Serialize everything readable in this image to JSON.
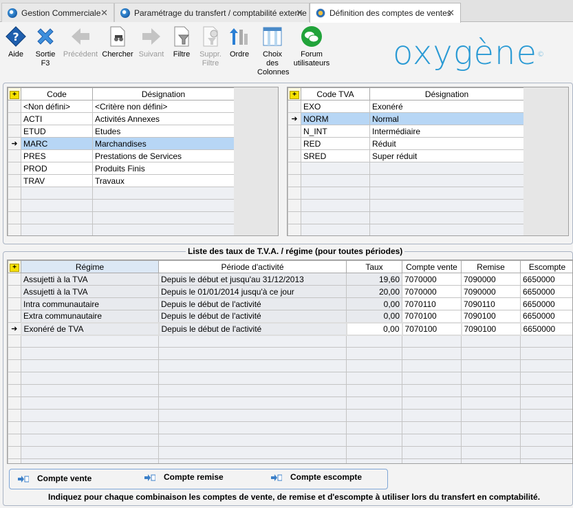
{
  "tabs": [
    {
      "label": "Gestion Commerciale",
      "icon": "app-icon"
    },
    {
      "label": "Paramétrage du transfert / comptabilité externe",
      "icon": "app-icon"
    },
    {
      "label": "Définition des comptes de ventes",
      "icon": "settings-icon"
    }
  ],
  "toolbar": {
    "aide": "Aide",
    "sortie": "Sortie F3",
    "precedent": "Précédent",
    "chercher": "Chercher",
    "suivant": "Suivant",
    "filtre": "Filtre",
    "suppr_filtre": "Suppr. Filtre",
    "ordre": "Ordre",
    "choix_colonnes": "Choix des Colonnes",
    "forum": "Forum utilisateurs"
  },
  "logo": {
    "text": "oxygène",
    "tm": "©"
  },
  "left_grid": {
    "headers": {
      "code": "Code",
      "designation": "Désignation"
    },
    "rows": [
      {
        "code": "<Non défini>",
        "designation": "<Critère non défini>"
      },
      {
        "code": "ACTI",
        "designation": "Activités Annexes"
      },
      {
        "code": "ETUD",
        "designation": "Etudes"
      },
      {
        "code": "MARC",
        "designation": "Marchandises"
      },
      {
        "code": "PRES",
        "designation": "Prestations de Services"
      },
      {
        "code": "PROD",
        "designation": "Produits Finis"
      },
      {
        "code": "TRAV",
        "designation": "Travaux"
      }
    ],
    "selected_row": 3
  },
  "right_grid": {
    "headers": {
      "code": "Code TVA",
      "designation": "Désignation"
    },
    "rows": [
      {
        "code": "EXO",
        "designation": "Exonéré"
      },
      {
        "code": "NORM",
        "designation": "Normal"
      },
      {
        "code": "N_INT",
        "designation": "Intermédiaire"
      },
      {
        "code": "RED",
        "designation": "Réduit"
      },
      {
        "code": "SRED",
        "designation": "Super réduit"
      }
    ],
    "selected_row": 1
  },
  "rates": {
    "title": "Liste des taux de T.V.A. / régime (pour toutes périodes)",
    "headers": {
      "regime": "Régime",
      "periode": "Période d'activité",
      "taux": "Taux",
      "compte_vente": "Compte vente",
      "remise": "Remise",
      "escompte": "Escompte"
    },
    "rows": [
      {
        "regime": "Assujetti à la TVA",
        "periode": "Depuis le début et jusqu'au 31/12/2013",
        "taux": "19,60",
        "compte_vente": "7070000",
        "remise": "7090000",
        "escompte": "6650000"
      },
      {
        "regime": "Assujetti à la TVA",
        "periode": "Depuis le 01/01/2014 jusqu'à ce jour",
        "taux": "20,00",
        "compte_vente": "7070000",
        "remise": "7090000",
        "escompte": "6650000"
      },
      {
        "regime": "Intra communautaire",
        "periode": "Depuis le début de l'activité",
        "taux": "0,00",
        "compte_vente": "7070110",
        "remise": "7090110",
        "escompte": "6650000"
      },
      {
        "regime": "Extra communautaire",
        "periode": "Depuis le début de l'activité",
        "taux": "0,00",
        "compte_vente": "7070100",
        "remise": "7090100",
        "escompte": "6650000"
      },
      {
        "regime": "Exonéré de TVA",
        "periode": "Depuis le début de l'activité",
        "taux": "0,00",
        "compte_vente": "7070100",
        "remise": "7090100",
        "escompte": "6650000"
      }
    ],
    "selected_row": 4
  },
  "bottom": {
    "compte_vente": "Compte vente",
    "compte_remise": "Compte remise",
    "compte_escompte": "Compte escompte",
    "hint": "Indiquez pour chaque combinaison les comptes de vente, de remise et d'escompte à utiliser lors du transfert en comptabilité."
  },
  "colors": {
    "accent": "#2a9ad4",
    "selection": "#b7d6f5",
    "grid_empty": "#eef0f4"
  }
}
